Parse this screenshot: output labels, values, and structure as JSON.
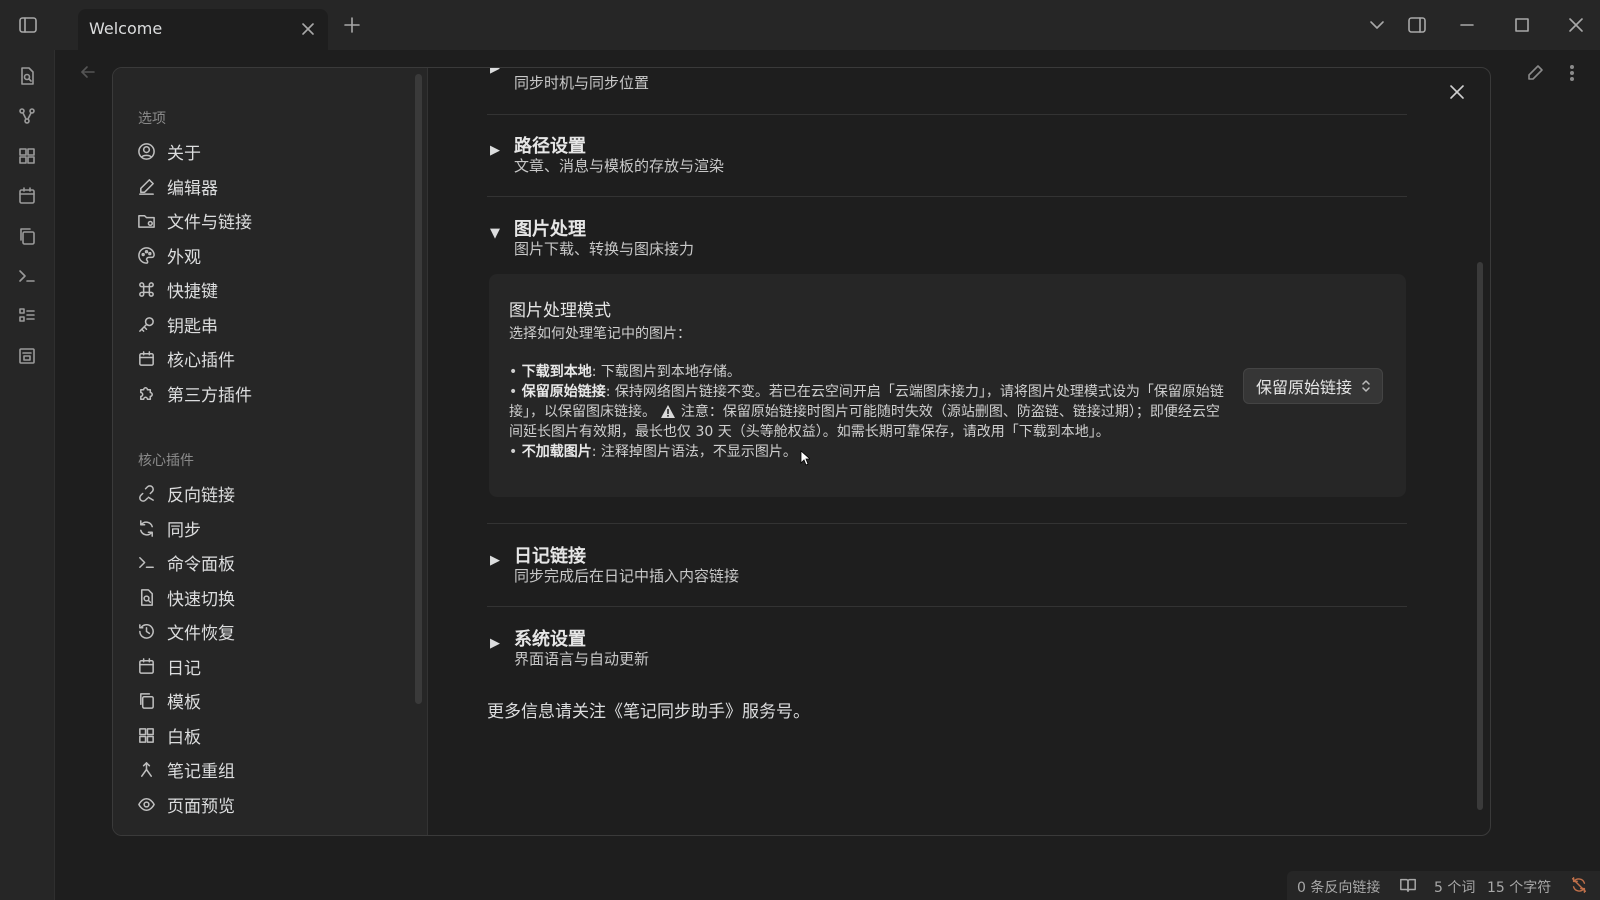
{
  "window": {
    "tab_title": "Welcome"
  },
  "settings_sidebar": {
    "options_group_label": "选项",
    "options_items": [
      {
        "label": "关于",
        "icon": "user-circle-icon"
      },
      {
        "label": "编辑器",
        "icon": "pencil-icon"
      },
      {
        "label": "文件与链接",
        "icon": "folder-cog-icon"
      },
      {
        "label": "外观",
        "icon": "palette-icon"
      },
      {
        "label": "快捷键",
        "icon": "command-icon"
      },
      {
        "label": "钥匙串",
        "icon": "key-icon"
      },
      {
        "label": "核心插件",
        "icon": "calendar-box-icon"
      },
      {
        "label": "第三方插件",
        "icon": "puzzle-icon"
      }
    ],
    "core_group_label": "核心插件",
    "core_items": [
      {
        "label": "反向链接",
        "icon": "backlink-icon"
      },
      {
        "label": "同步",
        "icon": "sync-icon"
      },
      {
        "label": "命令面板",
        "icon": "terminal-icon"
      },
      {
        "label": "快速切换",
        "icon": "file-search-icon"
      },
      {
        "label": "文件恢复",
        "icon": "history-icon"
      },
      {
        "label": "日记",
        "icon": "calendar-icon"
      },
      {
        "label": "模板",
        "icon": "copy-icon"
      },
      {
        "label": "白板",
        "icon": "grid-icon"
      },
      {
        "label": "笔记重组",
        "icon": "merge-icon"
      },
      {
        "label": "页面预览",
        "icon": "eye-icon"
      }
    ]
  },
  "content": {
    "partial_section_desc": "同步时机与同步位置",
    "sections": {
      "path": {
        "title": "路径设置",
        "desc": "文章、消息与模板的存放与渲染"
      },
      "image": {
        "title": "图片处理",
        "desc": "图片下载、转换与图床接力"
      },
      "diary": {
        "title": "日记链接",
        "desc": "同步完成后在日记中插入内容链接"
      },
      "system": {
        "title": "系统设置",
        "desc": "界面语言与自动更新"
      }
    },
    "image_mode": {
      "title": "图片处理模式",
      "intro": "选择如何处理笔记中的图片：",
      "opt1_name": "下载到本地",
      "opt1_desc": ": 下载图片到本地存储。",
      "opt2_name": "保留原始链接",
      "opt2_desc": ": 保持网络图片链接不变。若已在云空间开启「云端图床接力」，请将图片处理模式设为「保留原始链接」，以保留图床链接。",
      "opt2_warn": "注意：保留原始链接时图片可能随时失效（源站删图、防盗链、链接过期）；即便经云空间延长图片有效期，最长也仅 30 天（头等舱权益）。如需长期可靠保存，请改用「下载到本地」。",
      "opt3_name": "不加载图片",
      "opt3_desc": ": 注释掉图片语法，不显示图片。",
      "selected": "保留原始链接"
    },
    "footer_note": "更多信息请关注《笔记同步助手》服务号。"
  },
  "status_bar": {
    "backlinks": "0 条反向链接",
    "words": "5 个词",
    "chars": "15 个字符"
  }
}
